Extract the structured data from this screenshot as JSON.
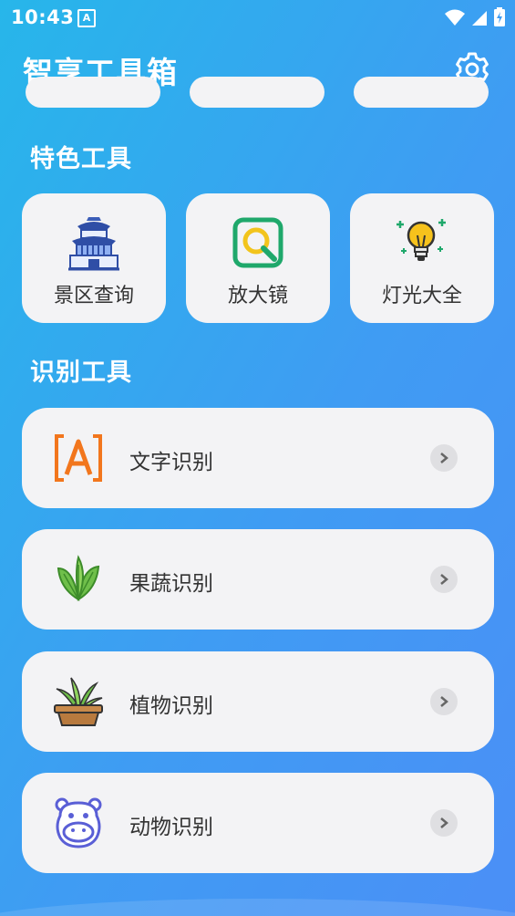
{
  "status_bar": {
    "time": "10:43",
    "notification_letter": "A"
  },
  "header": {
    "title": "智享工具箱",
    "settings_icon": "gear-icon"
  },
  "featured": {
    "title": "特色工具",
    "items": [
      {
        "label": "景区查询",
        "icon": "temple-icon"
      },
      {
        "label": "放大镜",
        "icon": "magnifier-icon"
      },
      {
        "label": "灯光大全",
        "icon": "lightbulb-icon"
      }
    ]
  },
  "recognition": {
    "title": "识别工具",
    "items": [
      {
        "label": "文字识别",
        "icon": "text-scan-icon"
      },
      {
        "label": "果蔬识别",
        "icon": "leaves-icon"
      },
      {
        "label": "植物识别",
        "icon": "potted-plant-icon"
      },
      {
        "label": "动物识别",
        "icon": "hippo-icon"
      }
    ]
  },
  "colors": {
    "gradient_start": "#27b6ea",
    "gradient_end": "#4b8ff6",
    "card_bg": "#f3f3f5",
    "text_orange": "#f2761d",
    "magnifier_green": "#1fa86b",
    "hippo_purple": "#5a5fd6"
  }
}
